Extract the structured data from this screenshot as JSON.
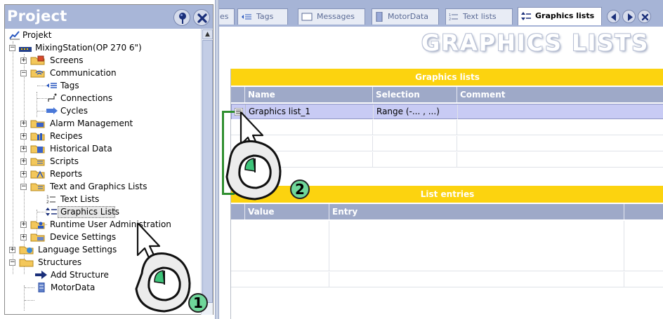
{
  "left_panel": {
    "title": "Project",
    "tree": [
      {
        "id": "projekt",
        "label": "Projekt"
      },
      {
        "id": "mixingstation",
        "label": "MixingStation(OP 270 6\")"
      },
      {
        "id": "screens",
        "label": "Screens"
      },
      {
        "id": "communication",
        "label": "Communication"
      },
      {
        "id": "tags",
        "label": "Tags"
      },
      {
        "id": "connections",
        "label": "Connections"
      },
      {
        "id": "cycles",
        "label": "Cycles"
      },
      {
        "id": "alarm",
        "label": "Alarm Management"
      },
      {
        "id": "recipes",
        "label": "Recipes"
      },
      {
        "id": "historical",
        "label": "Historical Data"
      },
      {
        "id": "scripts",
        "label": "Scripts"
      },
      {
        "id": "reports",
        "label": "Reports"
      },
      {
        "id": "textgraphics",
        "label": "Text and Graphics Lists"
      },
      {
        "id": "textlists",
        "label": "Text Lists"
      },
      {
        "id": "graphicslists",
        "label": "Graphics Lists"
      },
      {
        "id": "runtimeuser",
        "label": "Runtime User Administration"
      },
      {
        "id": "device",
        "label": "Device Settings"
      },
      {
        "id": "language",
        "label": "Language Settings"
      },
      {
        "id": "structures",
        "label": "Structures"
      },
      {
        "id": "addstructure",
        "label": "Add Structure"
      },
      {
        "id": "motordata",
        "label": "MotorData"
      }
    ]
  },
  "tabs": [
    {
      "label": "es"
    },
    {
      "label": "Tags"
    },
    {
      "label": "Messages"
    },
    {
      "label": "MotorData"
    },
    {
      "label": "Text lists"
    },
    {
      "label": "Graphics lists",
      "active": true
    }
  ],
  "editor": {
    "big_title": "GRAPHICS LISTS",
    "graphics_lists": {
      "caption": "Graphics lists",
      "columns": [
        "Name",
        "Selection",
        "Comment"
      ],
      "rows": [
        {
          "name": "Graphics list_1",
          "selection": "Range (-... , ...)",
          "comment": ""
        }
      ]
    },
    "list_entries": {
      "caption": "List entries",
      "columns": [
        "Value",
        "Entry"
      ]
    }
  },
  "callouts": [
    "1",
    "2"
  ],
  "colors": {
    "header_blue": "#a8b6d8",
    "yellow_caption": "#fcd30f",
    "column_header": "#9ea9c8",
    "selected_row": "#c8cbf4",
    "callout_green": "#6fd79a"
  }
}
